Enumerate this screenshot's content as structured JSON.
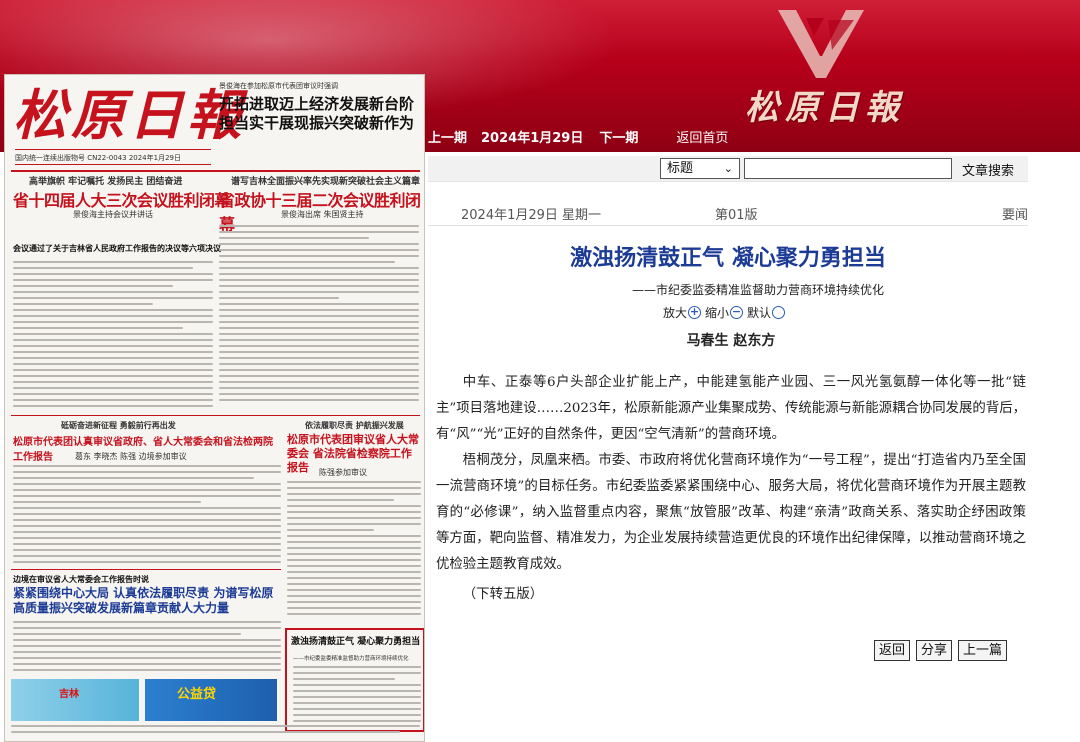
{
  "banner": {
    "logo_title": "松原日報"
  },
  "nav": {
    "prev": "上一期",
    "date": "2024年1月29日",
    "next": "下一期",
    "home": "返回首页"
  },
  "search": {
    "field_selected": "标题",
    "input_value": "",
    "button_label": "文章搜索"
  },
  "meta": {
    "date": "2024年1月29日 星期一",
    "page": "第01版",
    "section": "要闻"
  },
  "article": {
    "title": "激浊扬清鼓正气 凝心聚力勇担当",
    "subtitle": "——市纪委监委精准监督助力营商环境持续优化",
    "zoom_in": "放大",
    "zoom_out": "缩小",
    "zoom_default": "默认",
    "authors": "马春生 赵东方",
    "paragraphs": [
      "中车、正泰等6户头部企业扩能上产，中能建氢能产业园、三一风光氢氨醇一体化等一批“链主”项目落地建设……2023年，松原新能源产业集聚成势、传统能源与新能源耦合协同发展的背后，有“风”“光”正好的自然条件，更因“空气清新”的营商环境。",
      "梧桐茂分，凤凰来栖。市委、市政府将优化营商环境作为“一号工程”，提出“打造省内乃至全国一流营商环境”的目标任务。市纪委监委紧紧围绕中心、服务大局，将优化营商环境作为开展主题教育的“必修课”，纳入监督重点内容，聚焦“放管服”改革、构建“亲清”政商关系、落实助企纾困政策等方面，靶向监督、精准发力，为企业发展持续营造更优良的环境作出纪律保障，以推动营商环境之优检验主题教育成效。"
    ],
    "continued": "（下转五版）"
  },
  "buttons": {
    "back": "返回",
    "share": "分享",
    "prev_article": "上一篇"
  },
  "paper": {
    "masthead": "松原日報",
    "masthead_info": "国内统一连续出版物号 CN22-0043 2024年1月29日",
    "top_kicker": "景俊海在参加松原市代表团审议时强调",
    "top_title": "开拓进取迈上经济发展新台阶 担当实干展现振兴突破新作为",
    "left_kicker": "高举旗帜 牢记嘱托 发扬民主 团结奋进",
    "left_head": "省十四届人大三次会议胜利闭幕",
    "left_sub": "景俊海主持会议并讲话",
    "left_line": "会议通过了关于吉林省人民政府工作报告的决议等六项决议",
    "right_kicker": "谱写吉林全面振兴率先实现新突破社会主义篇章",
    "right_head": "省政协十三届二次会议胜利闭幕",
    "right_sub": "景俊海出席 朱国贤主持",
    "mid_kicker1": "砥砺奋进新征程 勇毅前行再出发",
    "mid_head1": "松原市代表团认真审议省政府、省人大常委会和省法检两院工作报告",
    "mid_sub1": "葛东 李晓杰 陈强 边境参加审议",
    "mid_kicker2": "依法履职尽责 护航振兴发展",
    "mid_head2": "松原市代表团审议省人大常委会 省法院省检察院工作报告",
    "mid_sub2": "陈强参加审议",
    "low_kicker": "边境在审议省人大常委会工作报告时说",
    "low_head": "紧紧围绕中心大局 认真依法履职尽责 为谱写松原高质量振兴突破发展新篇章贡献人大力量",
    "box_title": "激浊扬清鼓正气 凝心聚力勇担当",
    "box_sub": "——市纪委监委精准监督助力营商环境持续优化",
    "ad1_text": "吉林",
    "ad2_text": "公益贷"
  },
  "colors": {
    "banner_red": "#b4001a",
    "title_blue": "#1c3b95",
    "paper_red": "#c5121d"
  }
}
